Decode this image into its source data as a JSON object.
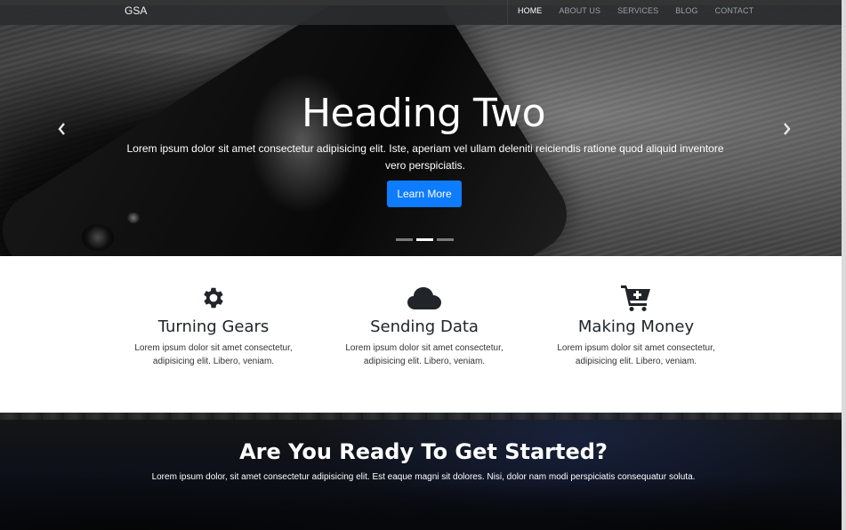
{
  "navbar": {
    "brand": "GSA",
    "links": [
      {
        "label": "HOME",
        "active": true
      },
      {
        "label": "ABOUT US",
        "active": false
      },
      {
        "label": "SERVICES",
        "active": false
      },
      {
        "label": "BLOG",
        "active": false
      },
      {
        "label": "CONTACT",
        "active": false
      }
    ]
  },
  "hero": {
    "title": "Heading Two",
    "text": "Lorem ipsum dolor sit amet consectetur adipisicing elit. Iste, aperiam vel ullam deleniti reiciendis ratione quod aliquid inventore vero perspiciatis.",
    "button": "Learn More",
    "prev_icon": "chevron-left-icon",
    "next_icon": "chevron-right-icon",
    "active_slide": 2,
    "slide_count": 3
  },
  "features": [
    {
      "icon": "cog-icon",
      "title": "Turning Gears",
      "text": "Lorem ipsum dolor sit amet consectetur, adipisicing elit. Libero, veniam."
    },
    {
      "icon": "cloud-icon",
      "title": "Sending Data",
      "text": "Lorem ipsum dolor sit amet consectetur, adipisicing elit. Libero, veniam."
    },
    {
      "icon": "cart-plus-icon",
      "title": "Making Money",
      "text": "Lorem ipsum dolor sit amet consectetur, adipisicing elit. Libero, veniam."
    }
  ],
  "cta": {
    "title": "Are You Ready To Get Started?",
    "text": "Lorem ipsum dolor, sit amet consectetur adipisicing elit. Est eaque magni sit dolores. Nisi, dolor nam modi perspiciatis consequatur soluta."
  },
  "colors": {
    "primary": "#0d7cff",
    "navbar": "#2a2c2e",
    "icon": "#212529"
  }
}
